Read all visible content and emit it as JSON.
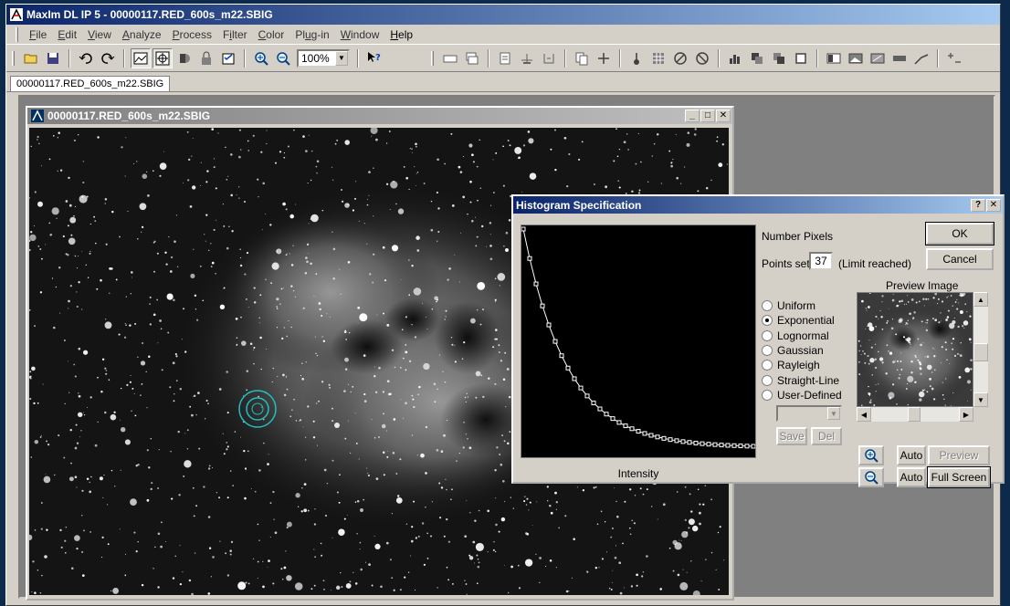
{
  "app": {
    "title": "MaxIm DL IP 5 - 00000117.RED_600s_m22.SBIG"
  },
  "menu": [
    {
      "label": "File",
      "key": "F",
      "rest": "ile"
    },
    {
      "label": "Edit",
      "key": "E",
      "rest": "dit"
    },
    {
      "label": "View",
      "key": "V",
      "rest": "iew"
    },
    {
      "label": "Analyze",
      "key": "A",
      "rest": "nalyze"
    },
    {
      "label": "Process",
      "key": "P",
      "rest": "rocess"
    },
    {
      "label": "Filter",
      "key": "i",
      "pre": "F",
      "rest": "lter"
    },
    {
      "label": "Color",
      "key": "C",
      "rest": "olor"
    },
    {
      "label": "Plug-in",
      "key": "u",
      "pre": "Pl",
      "rest": "g-in"
    },
    {
      "label": "Window",
      "key": "W",
      "rest": "indow"
    },
    {
      "label": "Help",
      "key": "H",
      "rest": "elp"
    }
  ],
  "toolbar": {
    "zoom_value": "100%"
  },
  "doc_tab": {
    "label": "00000117.RED_600s_m22.SBIG"
  },
  "image_window": {
    "title": "00000117.RED_600s_m22.SBIG"
  },
  "dialog": {
    "title": "Histogram Specification",
    "number_pixels_label": "Number Pixels",
    "points_set_label": "Points set:",
    "points_set_value": "37",
    "limit_reached": "(Limit reached)",
    "preview_image_label": "Preview Image",
    "intensity_label": "Intensity",
    "ok_label": "OK",
    "cancel_label": "Cancel",
    "save_label": "Save",
    "del_label": "Del",
    "auto_label_1": "Auto",
    "auto_label_2": "Auto",
    "preview_button_label": "Preview",
    "full_screen_label": "Full Screen",
    "distributions": [
      {
        "label": "Uniform",
        "checked": false
      },
      {
        "label": "Exponential",
        "checked": true
      },
      {
        "label": "Lognormal",
        "checked": false
      },
      {
        "label": "Gaussian",
        "checked": false
      },
      {
        "label": "Rayleigh",
        "checked": false
      },
      {
        "label": "Straight-Line",
        "checked": false
      },
      {
        "label": "User-Defined",
        "checked": false
      }
    ]
  }
}
